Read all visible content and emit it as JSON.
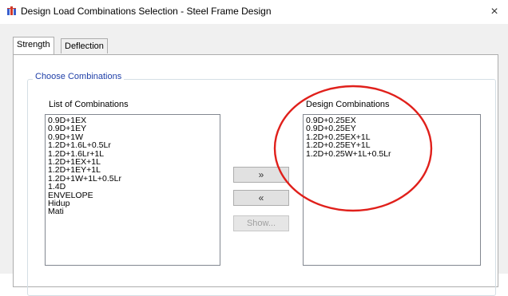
{
  "window": {
    "title": "Design Load Combinations Selection - Steel Frame Design",
    "close_glyph": "×"
  },
  "tabs": [
    {
      "label": "Strength",
      "active": true
    },
    {
      "label": "Deflection",
      "active": false
    }
  ],
  "group": {
    "title": "Choose Combinations"
  },
  "list_of_combinations": {
    "label": "List of Combinations",
    "items": [
      "0.9D+1EX",
      "0.9D+1EY",
      "0.9D+1W",
      "1.2D+1.6L+0.5Lr",
      "1.2D+1.6Lr+1L",
      "1.2D+1EX+1L",
      "1.2D+1EY+1L",
      "1.2D+1W+1L+0.5Lr",
      "1.4D",
      "ENVELOPE",
      "Hidup",
      "Mati"
    ]
  },
  "design_combinations": {
    "label": "Design Combinations",
    "items": [
      "0.9D+0.25EX",
      "0.9D+0.25EY",
      "1.2D+0.25EX+1L",
      "1.2D+0.25EY+1L",
      "1.2D+0.25W+1L+0.5Lr"
    ]
  },
  "buttons": {
    "add": "»",
    "remove": "«",
    "show": "Show..."
  },
  "colors": {
    "annotation": "#e0201b",
    "group_title": "#1f3fa8",
    "icon_red": "#d23a2a",
    "icon_blue": "#3a5fcd"
  }
}
